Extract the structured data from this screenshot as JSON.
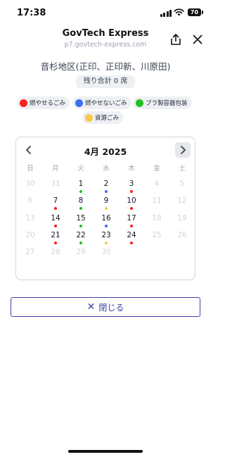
{
  "status": {
    "time": "17:38",
    "battery": "70"
  },
  "header": {
    "title": "GovTech Express",
    "url": "p7.govtech-express.com"
  },
  "area": {
    "title": "音杉地区(正印、正印新、川原田)",
    "remaining": "残り合計 0 席"
  },
  "legend": [
    {
      "label": "燃やせるごみ",
      "color": "#ff1e1e"
    },
    {
      "label": "燃やせないごみ",
      "color": "#3b6ef0"
    },
    {
      "label": "プラ製容器包装",
      "color": "#22c11f"
    },
    {
      "label": "資源ごみ",
      "color": "#f9c74f"
    }
  ],
  "calendar": {
    "month": "4月 2025",
    "weekdays": [
      "日",
      "月",
      "火",
      "水",
      "木",
      "金",
      "土"
    ],
    "weeks": [
      [
        {
          "d": "30",
          "out": true
        },
        {
          "d": "31",
          "out": true
        },
        {
          "d": "1",
          "dot": "#22c11f"
        },
        {
          "d": "2",
          "dot": "#3b6ef0"
        },
        {
          "d": "3",
          "dot": "#ff1e1e"
        },
        {
          "d": "4",
          "out": true
        },
        {
          "d": "5",
          "out": true
        }
      ],
      [
        {
          "d": "6",
          "out": true
        },
        {
          "d": "7",
          "dot": "#ff1e1e"
        },
        {
          "d": "8",
          "dot": "#22c11f"
        },
        {
          "d": "9",
          "dot": "#f9c74f"
        },
        {
          "d": "10",
          "dot": "#ff1e1e"
        },
        {
          "d": "11",
          "out": true
        },
        {
          "d": "12",
          "out": true
        }
      ],
      [
        {
          "d": "13",
          "out": true
        },
        {
          "d": "14",
          "dot": "#ff1e1e"
        },
        {
          "d": "15",
          "dot": "#22c11f"
        },
        {
          "d": "16",
          "dot": "#3b6ef0"
        },
        {
          "d": "17",
          "dot": "#ff1e1e"
        },
        {
          "d": "18",
          "out": true
        },
        {
          "d": "19",
          "out": true
        }
      ],
      [
        {
          "d": "20",
          "out": true
        },
        {
          "d": "21",
          "dot": "#ff1e1e"
        },
        {
          "d": "22",
          "dot": "#22c11f"
        },
        {
          "d": "23",
          "dot": "#f9c74f"
        },
        {
          "d": "24",
          "dot": "#ff1e1e"
        },
        {
          "d": "25",
          "out": true
        },
        {
          "d": "26",
          "out": true
        }
      ],
      [
        {
          "d": "27",
          "out": true
        },
        {
          "d": "28",
          "out": true
        },
        {
          "d": "29",
          "out": true
        },
        {
          "d": "30",
          "out": true
        },
        {
          "d": "",
          "out": true
        },
        {
          "d": "",
          "out": true
        },
        {
          "d": "",
          "out": true
        }
      ]
    ]
  },
  "close_button": {
    "icon": "✕",
    "label": "閉じる"
  }
}
